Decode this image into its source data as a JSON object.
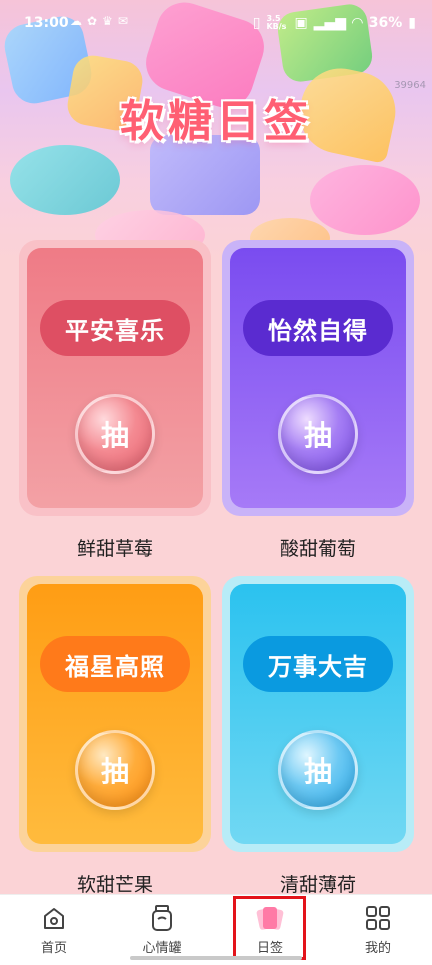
{
  "status_bar": {
    "time": "13:00",
    "network_speed": "3.5 KB/s",
    "battery": "36%"
  },
  "header": {
    "title": "软糖日签",
    "watermark": "39964"
  },
  "cards": [
    {
      "blessing": "平安喜乐",
      "draw_label": "抽",
      "name": "鲜甜草莓",
      "theme": "red",
      "accent": "#de4f63"
    },
    {
      "blessing": "怡然自得",
      "draw_label": "抽",
      "name": "酸甜葡萄",
      "theme": "purple",
      "accent": "#5a2bd0"
    },
    {
      "blessing": "福星高照",
      "draw_label": "抽",
      "name": "软甜芒果",
      "theme": "orange",
      "accent": "#ff7a1a"
    },
    {
      "blessing": "万事大吉",
      "draw_label": "抽",
      "name": "清甜薄荷",
      "theme": "cyan",
      "accent": "#0a9ae0"
    }
  ],
  "tabbar": {
    "items": [
      {
        "label": "首页",
        "icon": "home-icon"
      },
      {
        "label": "心情罐",
        "icon": "jar-icon"
      },
      {
        "label": "日签",
        "icon": "cards-icon",
        "active": true
      },
      {
        "label": "我的",
        "icon": "grid-icon"
      }
    ],
    "active_color": "#ff5d8f"
  }
}
